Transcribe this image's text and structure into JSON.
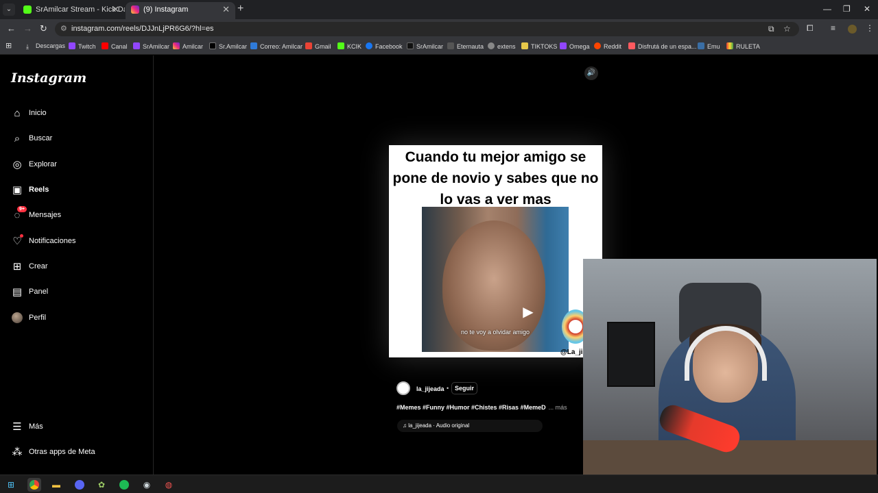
{
  "browser": {
    "tabs": [
      {
        "title": "SrAmilcar Stream - Kick Dashbo",
        "favicon": "kick-icon",
        "active": false
      },
      {
        "title": "(9) Instagram",
        "favicon": "instagram-icon",
        "active": true
      }
    ],
    "url": "instagram.com/reels/DJJnLjPR6G6/?hl=es",
    "bookmarks": [
      "Descargas",
      "Twitch",
      "Canal",
      "SrAmilcar",
      "Amilcar",
      "Sr.Amilcar",
      "Correo: Amilcar",
      "Gmail",
      "KCIK",
      "Facebook",
      "SrAmilcar",
      "Eternauta",
      "extens",
      "TIKTOKS",
      "Omega",
      "Reddit",
      "Disfrutá de un espa...",
      "Emu",
      "RULETA"
    ]
  },
  "sidebar": {
    "logo": "Instagram",
    "items": [
      {
        "label": "Inicio",
        "icon": "home-icon"
      },
      {
        "label": "Buscar",
        "icon": "search-icon"
      },
      {
        "label": "Explorar",
        "icon": "compass-icon"
      },
      {
        "label": "Reels",
        "icon": "reels-icon"
      },
      {
        "label": "Mensajes",
        "icon": "messenger-icon",
        "badge": "9+"
      },
      {
        "label": "Notificaciones",
        "icon": "heart-icon"
      },
      {
        "label": "Crear",
        "icon": "plus-icon"
      },
      {
        "label": "Panel",
        "icon": "chart-icon"
      },
      {
        "label": "Perfil",
        "icon": "avatar"
      }
    ],
    "bottom": [
      {
        "label": "Más",
        "icon": "menu-icon"
      },
      {
        "label": "Otras apps de Meta",
        "icon": "meta-apps-icon"
      }
    ]
  },
  "reel": {
    "caption": "Cuando tu mejor amigo se pone de novio y sabes que no lo vas a ver mas",
    "subtitle": "no te voy a olvidar amigo",
    "watermark": "@La_ji",
    "author": "la_jijeada",
    "follow_label": "Seguir",
    "tags": "#Memes #Funny #Humor #Chistes #Risas #MemeD",
    "more_label": "... más",
    "audio": "la_jijeada · Audio original"
  },
  "colors": {
    "background": "#000000",
    "badge": "#ff3040",
    "chrome_tabbar": "#202124",
    "chrome_toolbar": "#35363a"
  }
}
